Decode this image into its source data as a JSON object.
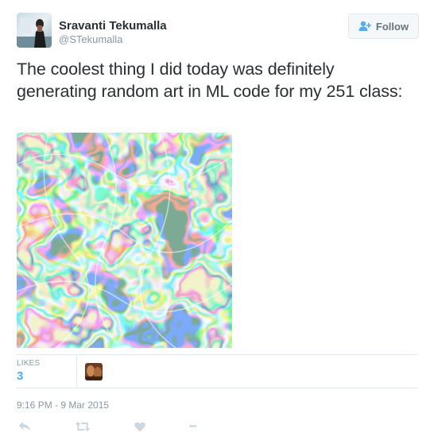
{
  "user": {
    "full_name": "Sravanti Tekumalla",
    "handle": "@STekumalla"
  },
  "follow_button": {
    "label": "Follow"
  },
  "tweet": {
    "text": "The coolest thing I did today was definitely generating random art in ML code for my 251 class:"
  },
  "stats": {
    "likes_label": "LIKES",
    "likes_count": "3"
  },
  "timestamp": "9:16 PM - 9 Mar 2015",
  "actions": {
    "more_label": "•••"
  },
  "colors": {
    "accent": "#55acee",
    "muted": "#8899a6",
    "text": "#292f33",
    "border": "#e1e8ed"
  },
  "icons": [
    "avatar-photo",
    "follow-person-plus-icon",
    "reply-icon",
    "retweet-icon",
    "like-heart-icon",
    "more-icon"
  ]
}
